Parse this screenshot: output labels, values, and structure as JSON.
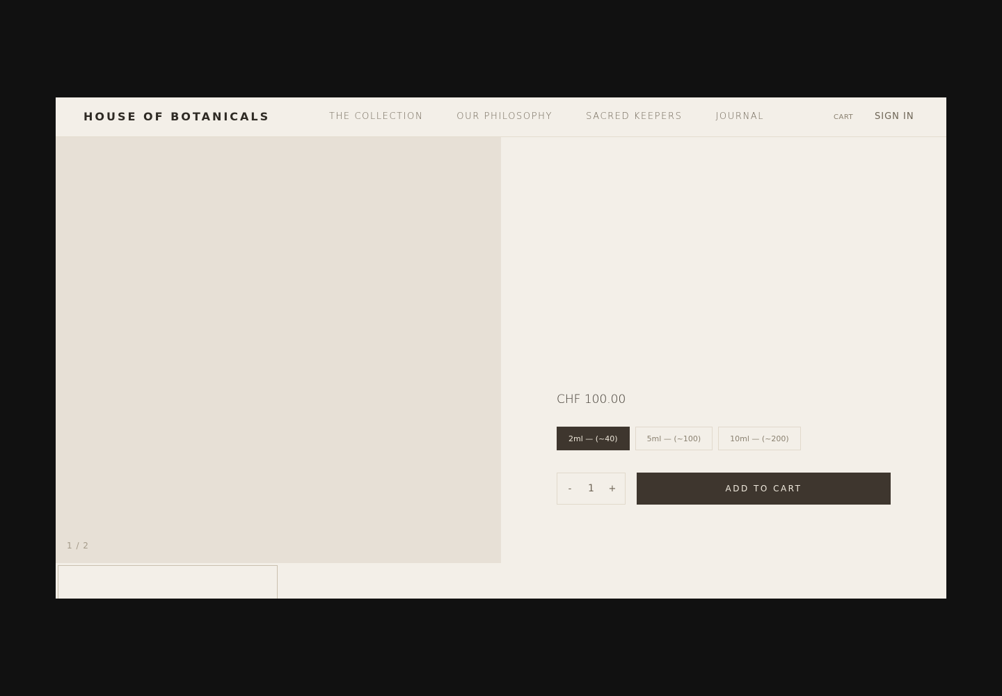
{
  "header": {
    "logo": "HOUSE OF BOTANICALS",
    "nav": [
      "THE COLLECTION",
      "OUR PHILOSOPHY",
      "SACRED KEEPERS",
      "JOURNAL"
    ],
    "cart": "CART",
    "sign_in": "SIGN IN"
  },
  "gallery": {
    "counter": "1 / 2"
  },
  "product": {
    "price": "CHF 100.00",
    "variants": [
      "2ml — (~40)",
      "5ml — (~100)",
      "10ml — (~200)"
    ],
    "selected_variant": "2ml — (~40)",
    "quantity": {
      "minus": "-",
      "value": "1",
      "plus": "+"
    },
    "add_to_cart": "ADD TO CART"
  },
  "colors": {
    "page_background": "#111111",
    "panel_background": "#f3efe8",
    "image_placeholder": "#e7e0d6",
    "accent_dark": "#3e362e"
  }
}
